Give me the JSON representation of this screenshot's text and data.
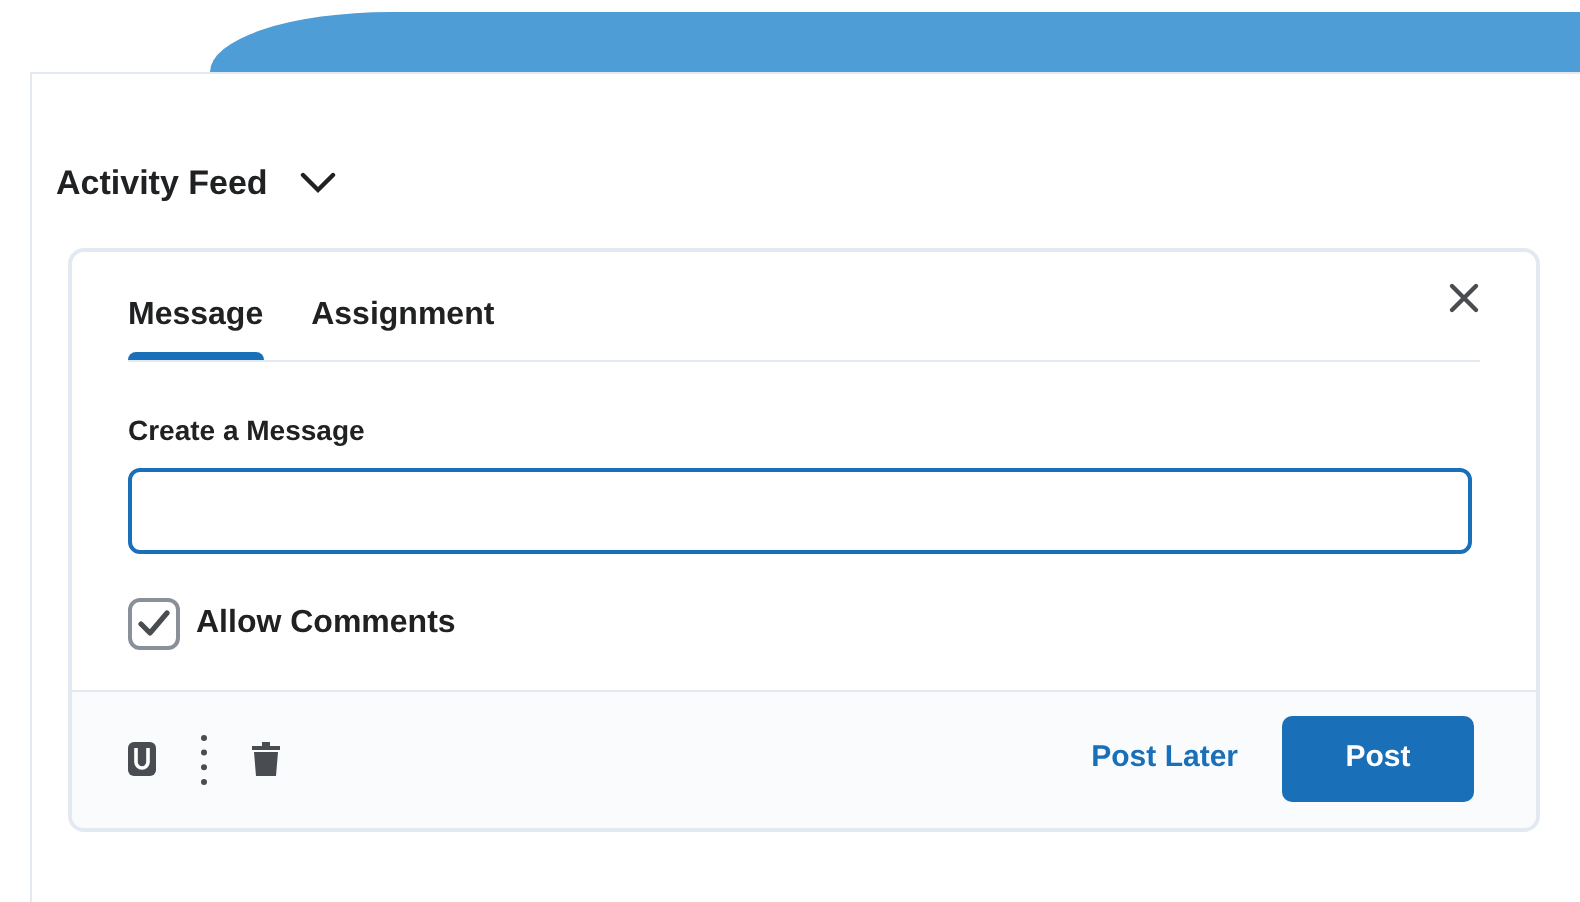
{
  "feed": {
    "title": "Activity Feed"
  },
  "tabs": [
    {
      "label": "Message",
      "selected": true
    },
    {
      "label": "Assignment",
      "selected": false
    }
  ],
  "form": {
    "label": "Create a Message",
    "allow_comments": {
      "label": "Allow Comments",
      "checked": true
    }
  },
  "footer": {
    "post_later": "Post Later",
    "post": "Post"
  }
}
